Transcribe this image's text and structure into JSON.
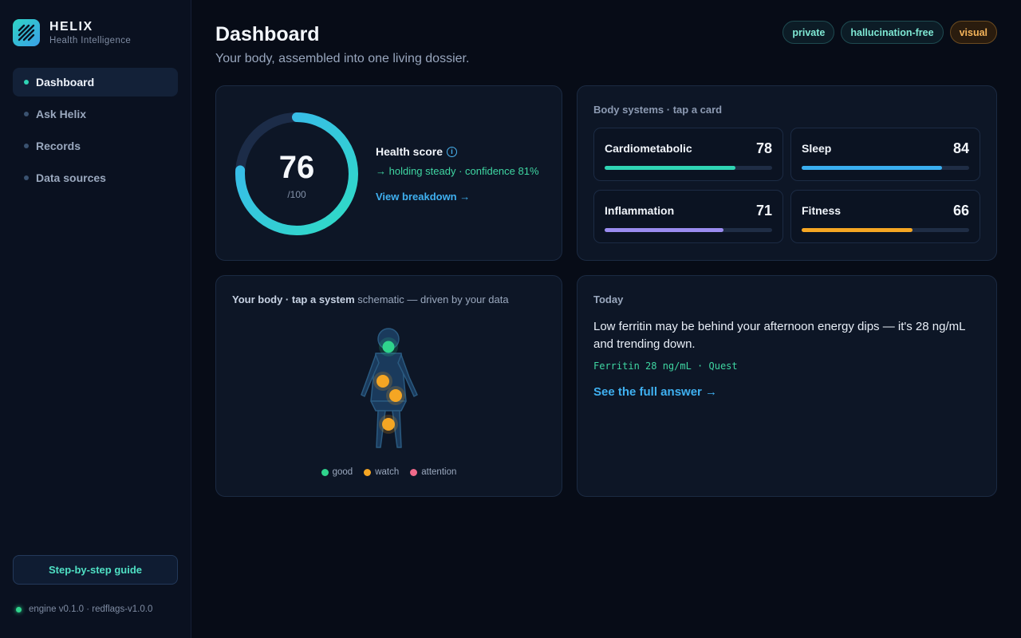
{
  "brand": {
    "name": "HELIX",
    "subtitle": "Health Intelligence",
    "logo_icon": "helix-stripes-icon"
  },
  "nav": {
    "items": [
      {
        "label": "Dashboard",
        "active": true
      },
      {
        "label": "Ask Helix",
        "active": false
      },
      {
        "label": "Records",
        "active": false
      },
      {
        "label": "Data sources",
        "active": false
      }
    ]
  },
  "sidebar_footer": {
    "guide_label": "Step-by-step guide",
    "engine_status": "engine v0.1.0 · redflags-v1.0.0"
  },
  "header": {
    "title": "Dashboard",
    "subtitle": "Your body, assembled into one living dossier.",
    "pills": [
      "private",
      "hallucination-free",
      "visual"
    ]
  },
  "health_score": {
    "value": "76",
    "max": "/100",
    "value_fraction": 0.76,
    "title": "Health score",
    "trend": "→ holding steady · confidence 81%",
    "link": "View breakdown →"
  },
  "systems": {
    "title": "Body systems · tap a card",
    "items": [
      {
        "name": "Cardiometabolic",
        "value": "78",
        "fraction": 0.78,
        "color": "#2fd4b4"
      },
      {
        "name": "Sleep",
        "value": "84",
        "fraction": 0.84,
        "color": "#3aaef0"
      },
      {
        "name": "Inflammation",
        "value": "71",
        "fraction": 0.71,
        "color": "#9a8cf0"
      },
      {
        "name": "Fitness",
        "value": "66",
        "fraction": 0.66,
        "color": "#f5a623"
      }
    ]
  },
  "body_panel": {
    "title_bold": "Your body · tap a system",
    "title_rest": " schematic — driven by your data",
    "legend": [
      {
        "label": "good",
        "color": "#2fd48c"
      },
      {
        "label": "watch",
        "color": "#f5a623"
      },
      {
        "label": "attention",
        "color": "#f06a8a"
      }
    ]
  },
  "today": {
    "title": "Today",
    "text": "Low ferritin may be behind your afternoon energy dips — it's 28 ng/mL and trending down.",
    "source": "Ferritin 28 ng/mL · Quest",
    "link": "See the full answer →"
  }
}
